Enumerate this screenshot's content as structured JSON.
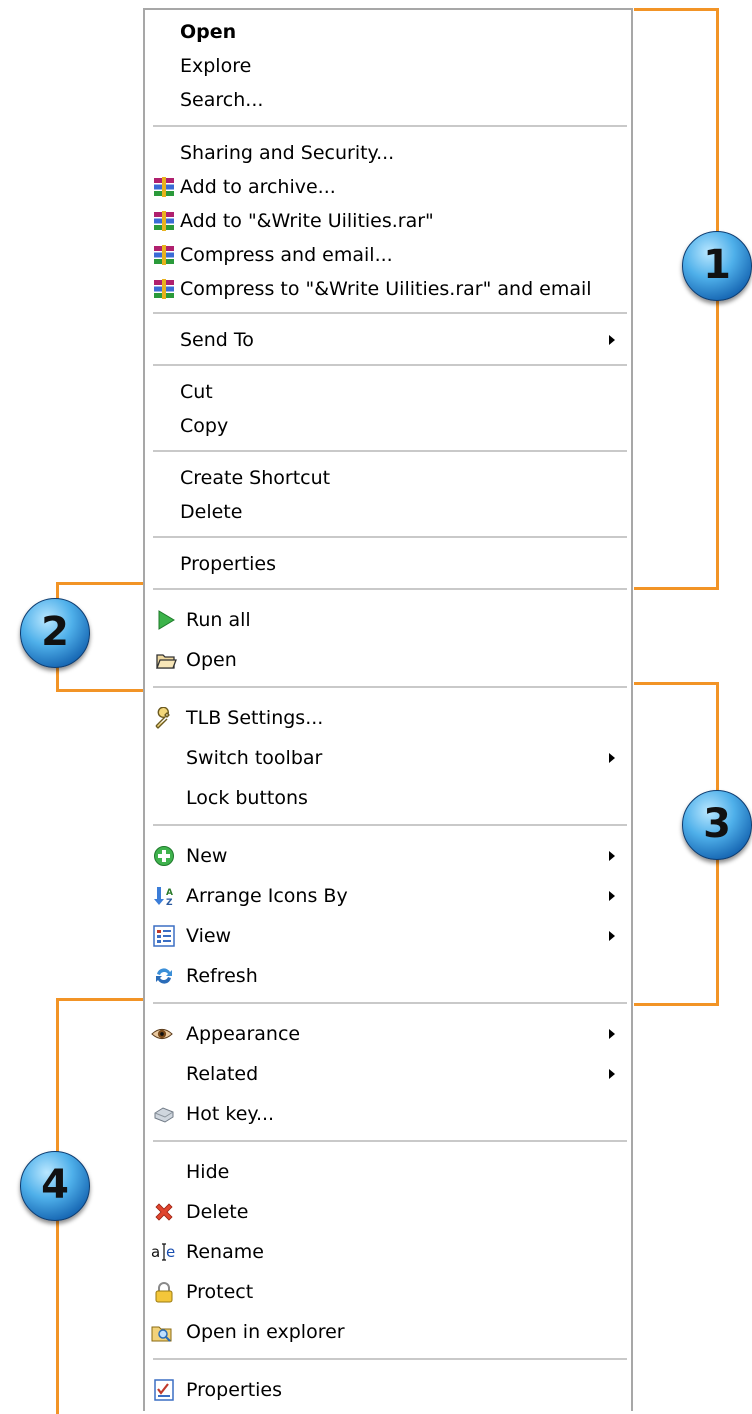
{
  "menu": {
    "open": "Open",
    "explore": "Explore",
    "search": "Search...",
    "sharing": "Sharing and Security...",
    "add_archive": "Add to archive...",
    "add_rar": "Add to \"&Write Uilities.rar\"",
    "compress_email": "Compress and email...",
    "compress_rar_email": "Compress to \"&Write Uilities.rar\" and email",
    "send_to": "Send To",
    "cut": "Cut",
    "copy": "Copy",
    "create_shortcut": "Create Shortcut",
    "delete": "Delete",
    "properties": "Properties",
    "run_all": "Run all",
    "open2": "Open",
    "tlb_settings": "TLB Settings...",
    "switch_toolbar": "Switch toolbar",
    "lock_buttons": "Lock buttons",
    "new": "New",
    "arrange_icons": "Arrange Icons By",
    "view": "View",
    "refresh": "Refresh",
    "appearance": "Appearance",
    "related": "Related",
    "hot_key": "Hot key...",
    "hide": "Hide",
    "delete2": "Delete",
    "rename": "Rename",
    "protect": "Protect",
    "open_in_explorer": "Open in explorer",
    "properties2": "Properties"
  },
  "callouts": [
    "1",
    "2",
    "3",
    "4"
  ],
  "colors": {
    "bracket": "#f29426",
    "badge": "#2f8fd6",
    "separator": "#c9c9c9"
  },
  "icons": {
    "winrar": "winrar-archive-icon",
    "run": "green-play-icon",
    "folder": "open-folder-icon",
    "wrench": "wrench-icon",
    "new": "green-plus-icon",
    "arrange": "sort-az-icon",
    "view": "view-list-icon",
    "refresh": "refresh-icon",
    "eye": "eye-icon",
    "hotkey": "keyboard-key-icon",
    "delete": "red-x-icon",
    "rename": "rename-text-cursor-icon",
    "protect": "padlock-icon",
    "explorer": "explorer-folder-icon",
    "properties": "properties-checklist-icon"
  }
}
